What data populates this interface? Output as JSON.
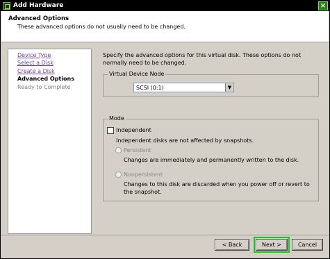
{
  "window": {
    "title": "Add Hardware",
    "close_symbol": "×",
    "icon": "vm-icon"
  },
  "header": {
    "title": "Advanced Options",
    "subtitle": "These advanced options do not usually need to be changed."
  },
  "nav": {
    "items": [
      {
        "label": "Device Type",
        "state": "link"
      },
      {
        "label": "Select a Disk",
        "state": "link"
      },
      {
        "label": "Create a Disk",
        "state": "link"
      },
      {
        "label": "Advanced Options",
        "state": "current"
      },
      {
        "label": "Ready to Complete",
        "state": "pending"
      }
    ]
  },
  "main": {
    "description": "Specify the advanced options for this virtual disk. These options do not normally need to be changed.",
    "virtual_device_node": {
      "legend": "Virtual Device Node",
      "selected": "SCSI (0:1)",
      "arrow": "▼"
    },
    "mode": {
      "legend": "Mode",
      "independent": {
        "label": "Independent",
        "checked": false,
        "description": "Independent disks are not affected by snapshots."
      },
      "persistent": {
        "label": "Persistent",
        "enabled": false,
        "description": "Changes are immediately and permanently written to the disk."
      },
      "nonpersistent": {
        "label": "Nonpersistent",
        "enabled": false,
        "description": "Changes to this disk are discarded when you power off or revert to the snapshot."
      }
    }
  },
  "footer": {
    "back_label": "< Back",
    "next_label": "Next >",
    "cancel_label": "Cancel"
  },
  "colors": {
    "link": "#6b3fa0",
    "default_button_highlight": "#19c81e",
    "dialog_background": "#d4d0c8"
  }
}
